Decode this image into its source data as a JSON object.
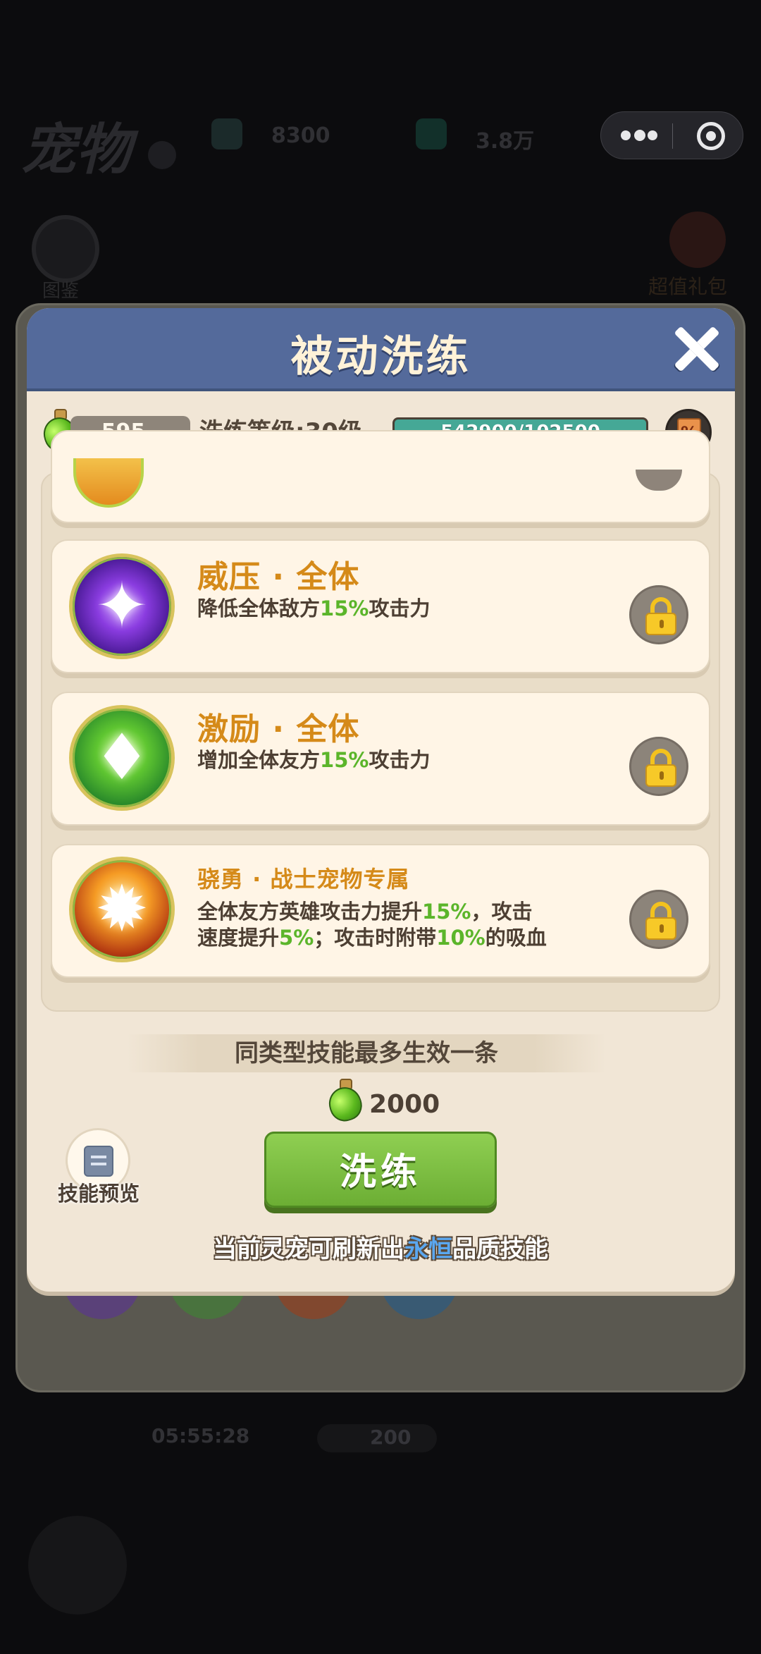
{
  "background": {
    "title": "宠物",
    "resource1": "8300",
    "resource2": "3.8万",
    "left_label": "图鉴",
    "right_label": "超值礼包",
    "timer": "05:55:28",
    "cost": "200"
  },
  "dialog": {
    "title": "被动洗练",
    "potion_count": "595",
    "level_label": "洗练等级:30级",
    "exp_text": "542900/102500",
    "exp_fraction": 1.0,
    "shop_icon_label": "%"
  },
  "skills": [
    {
      "name": "威压 · 全体",
      "desc_pre": "降低全体敌方",
      "desc_hl": "15%",
      "desc_post": "攻击力",
      "locked": true
    },
    {
      "name": "激励 · 全体",
      "desc_pre": "增加全体友方",
      "desc_hl": "15%",
      "desc_post": "攻击力",
      "locked": true
    },
    {
      "name": "骁勇 · 战士宠物专属",
      "desc_line1_pre": "全体友方英雄攻击力提升",
      "desc_line1_hl": "15%",
      "desc_line1_post": "，攻击",
      "desc_line2_pre": "速度提升",
      "desc_line2_hl1": "5%",
      "desc_line2_mid": "；攻击时附带",
      "desc_line2_hl2": "10%",
      "desc_line2_post": "的吸血",
      "locked": true
    }
  ],
  "footer": {
    "rule_text": "同类型技能最多生效一条",
    "cost": "2000",
    "preview_label": "技能预览",
    "wash_button": "洗练",
    "note_pre": "当前灵宠可刷新出",
    "note_quality": "永恒",
    "note_post": "品质技能"
  },
  "colors": {
    "header": "#546a9b",
    "accent_green": "#5bb52a",
    "skill_name": "#d58a19",
    "quality_blue": "#5aa7f0"
  }
}
